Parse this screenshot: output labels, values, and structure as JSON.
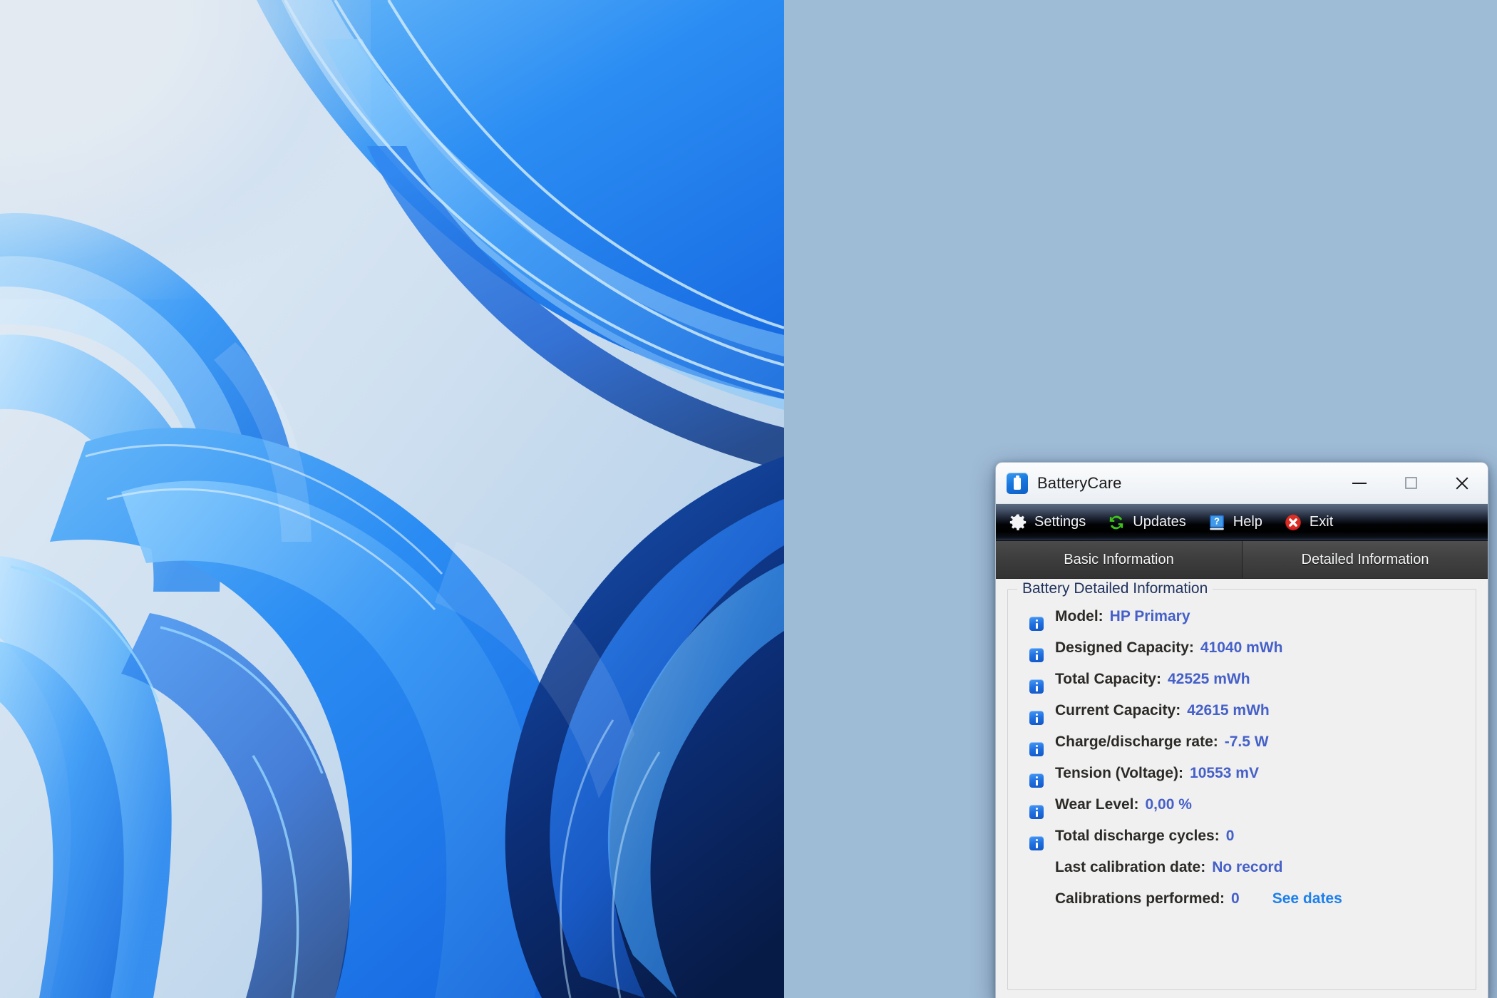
{
  "desktop": {
    "wallpaper_name": "windows-bloom-wallpaper"
  },
  "window": {
    "title": "BatteryCare",
    "icon": "battery-icon",
    "controls": {
      "minimize": "minimize-icon",
      "maximize": "maximize-icon",
      "close": "close-icon"
    }
  },
  "toolbar": {
    "items": [
      {
        "label": "Settings",
        "icon": "gear-icon"
      },
      {
        "label": "Updates",
        "icon": "refresh-icon"
      },
      {
        "label": "Help",
        "icon": "help-book-icon"
      },
      {
        "label": "Exit",
        "icon": "exit-circle-icon"
      }
    ]
  },
  "tabs": [
    {
      "label": "Basic Information",
      "active": false
    },
    {
      "label": "Detailed Information",
      "active": true
    }
  ],
  "panel": {
    "group_title": "Battery Detailed Information",
    "rows": [
      {
        "label": "Model:",
        "value": "HP Primary",
        "icon": true
      },
      {
        "label": "Designed Capacity:",
        "value": "41040 mWh",
        "icon": true
      },
      {
        "label": "Total Capacity:",
        "value": "42525 mWh",
        "icon": true
      },
      {
        "label": "Current Capacity:",
        "value": "42615 mWh",
        "icon": true
      },
      {
        "label": "Charge/discharge rate:",
        "value": "-7.5 W",
        "icon": true
      },
      {
        "label": "Tension (Voltage):",
        "value": "10553 mV",
        "icon": true
      },
      {
        "label": "Wear Level:",
        "value": "0,00 %",
        "icon": true
      },
      {
        "label": "Total discharge cycles:",
        "value": "0",
        "icon": true
      },
      {
        "label": "Last calibration date:",
        "value": "No record",
        "icon": false
      },
      {
        "label": "Calibrations performed:",
        "value": "0",
        "icon": false,
        "link": "See dates"
      }
    ]
  },
  "colors": {
    "desktop_bg": "#9fbcd7",
    "value_blue": "#4560c8",
    "link_blue": "#1e80ea",
    "group_title": "#20325e",
    "accent_blue": "#1f6fe0",
    "exit_red": "#d32020",
    "updates_green": "#3fc21a"
  }
}
